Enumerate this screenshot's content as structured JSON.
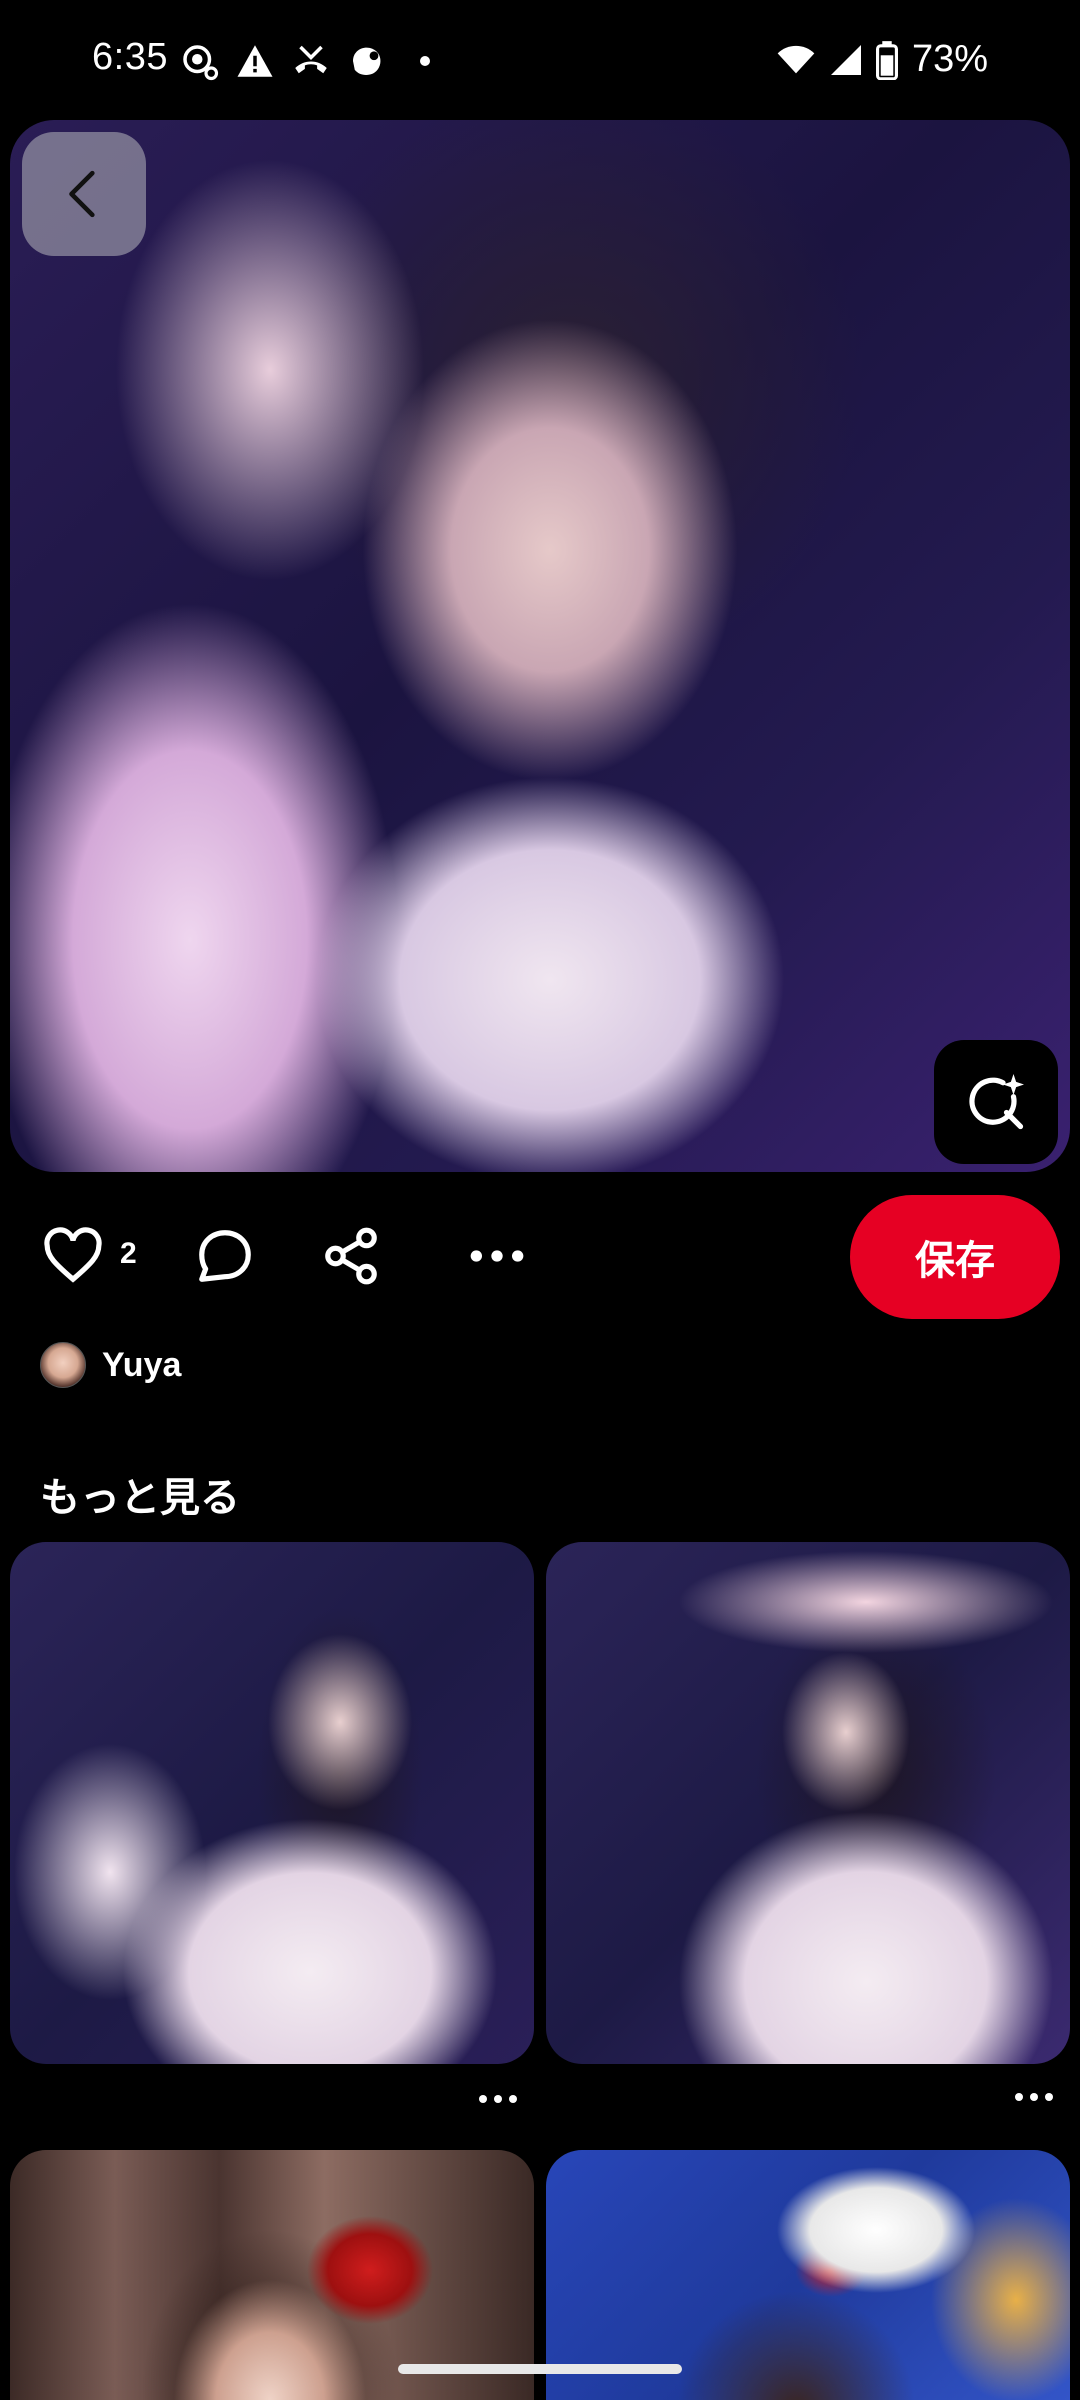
{
  "status_bar": {
    "time": "6:35",
    "battery": "73%"
  },
  "pin": {
    "like_count": "2",
    "save_label": "保存",
    "author_name": "Yuya"
  },
  "more": {
    "title": "もっと見る"
  },
  "colors": {
    "background": "#000000",
    "save_button": "#e60023",
    "text": "#ffffff"
  },
  "icons": [
    "back-icon",
    "visual-search-icon",
    "heart-icon",
    "comment-icon",
    "share-icon",
    "more-icon"
  ]
}
